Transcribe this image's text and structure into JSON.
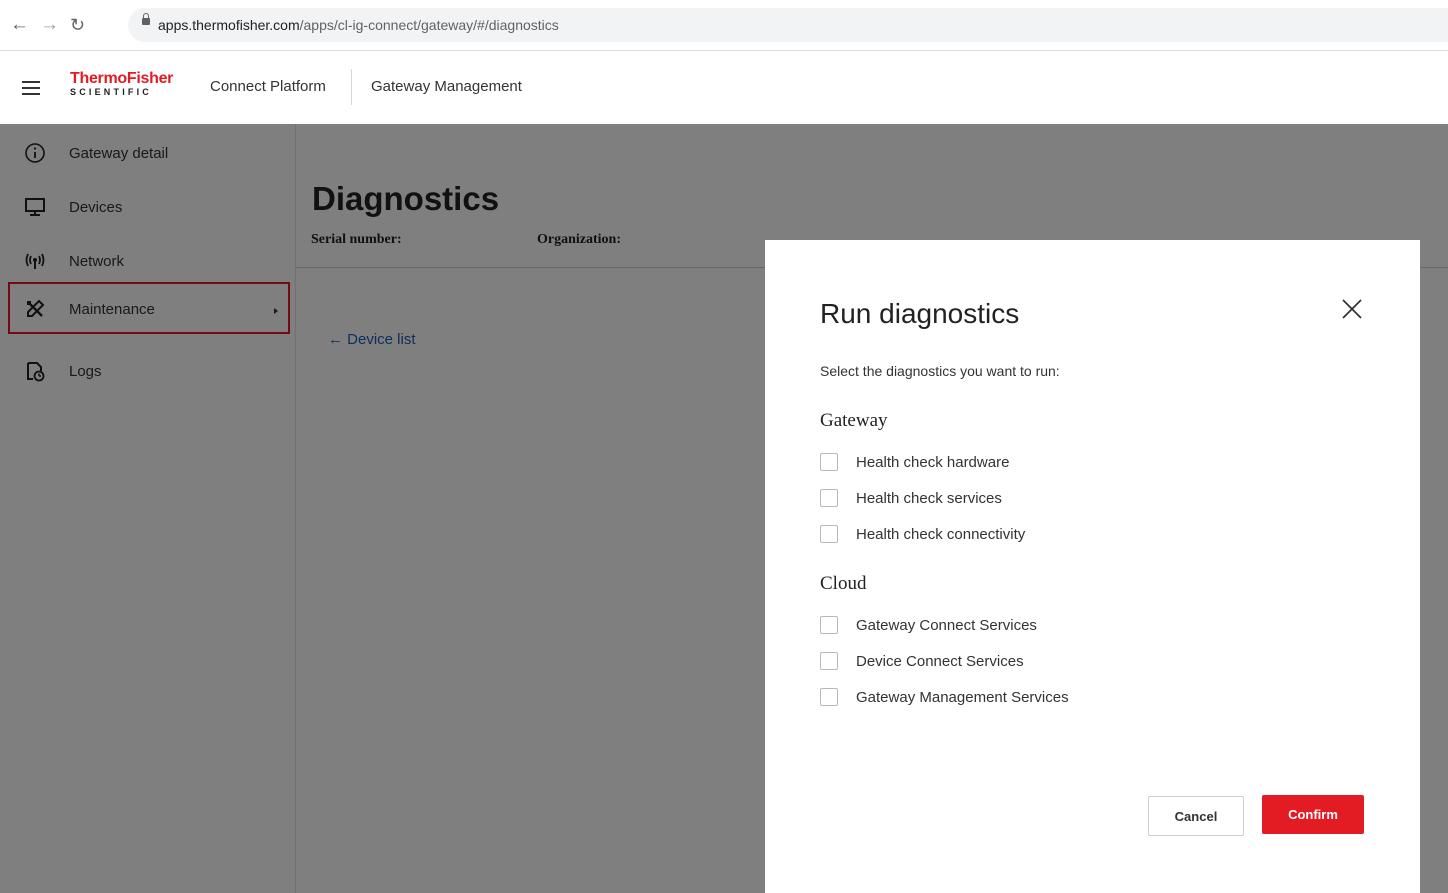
{
  "browser": {
    "url_host": "apps.thermofisher.com",
    "url_path": "/apps/cl-ig-connect/gateway/#/diagnostics"
  },
  "header": {
    "logo_top": "ThermoFisher",
    "logo_bottom": "SCIENTIFIC",
    "platform": "Connect Platform",
    "section": "Gateway Management"
  },
  "sidebar": {
    "items": [
      {
        "label": "Gateway detail",
        "icon": "info-icon"
      },
      {
        "label": "Devices",
        "icon": "monitor-icon"
      },
      {
        "label": "Network",
        "icon": "antenna-icon"
      },
      {
        "label": "Maintenance",
        "icon": "tools-icon",
        "active": true
      },
      {
        "label": "Logs",
        "icon": "log-file-icon"
      }
    ]
  },
  "main": {
    "title": "Diagnostics",
    "serial_label": "Serial number:",
    "org_label": "Organization:",
    "back_link": "← Device list"
  },
  "modal": {
    "title": "Run diagnostics",
    "subtitle": "Select the diagnostics you want to run:",
    "sections": [
      {
        "heading": "Gateway",
        "options": [
          "Health check hardware",
          "Health check services",
          "Health check connectivity"
        ]
      },
      {
        "heading": "Cloud",
        "options": [
          "Gateway Connect Services",
          "Device Connect Services",
          "Gateway Management Services"
        ]
      }
    ],
    "cancel_label": "Cancel",
    "confirm_label": "Confirm"
  },
  "colors": {
    "accent": "#e31b23",
    "link": "#1a5fb4",
    "overlay": "rgba(0,0,0,0.5)"
  }
}
